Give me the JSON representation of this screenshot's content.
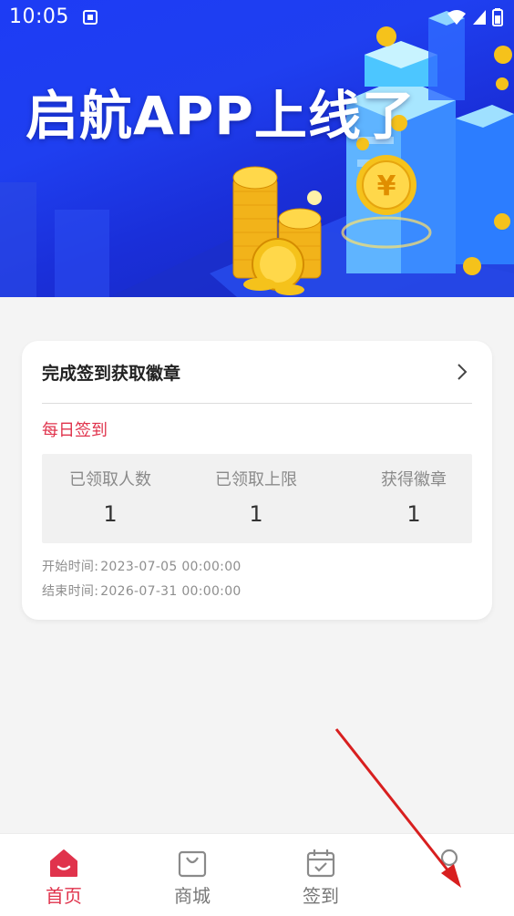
{
  "status_bar": {
    "time": "10:05"
  },
  "banner": {
    "title": "启航APP上线了",
    "coin_symbol": "¥"
  },
  "badge_card": {
    "title": "完成签到获取徽章",
    "section_label": "每日签到",
    "stats": [
      {
        "label": "已领取人数",
        "value": "1"
      },
      {
        "label": "已领取上限",
        "value": "1"
      },
      {
        "label": "获得徽章",
        "value": "1"
      }
    ],
    "start_label": "开始时间:",
    "start_time": "2023-07-05 00:00:00",
    "end_label": "结束时间:",
    "end_time": "2026-07-31 00:00:00"
  },
  "tabbar": {
    "items": [
      {
        "label": "首页",
        "icon": "home-icon",
        "active": true
      },
      {
        "label": "商城",
        "icon": "shopping-bag-icon",
        "active": false
      },
      {
        "label": "签到",
        "icon": "calendar-check-icon",
        "active": false
      },
      {
        "label": "",
        "icon": "profile-icon",
        "active": false
      }
    ]
  },
  "colors": {
    "accent": "#e0334c",
    "banner_blue": "#1d3cf5",
    "coin_gold": "#f5c21b"
  }
}
